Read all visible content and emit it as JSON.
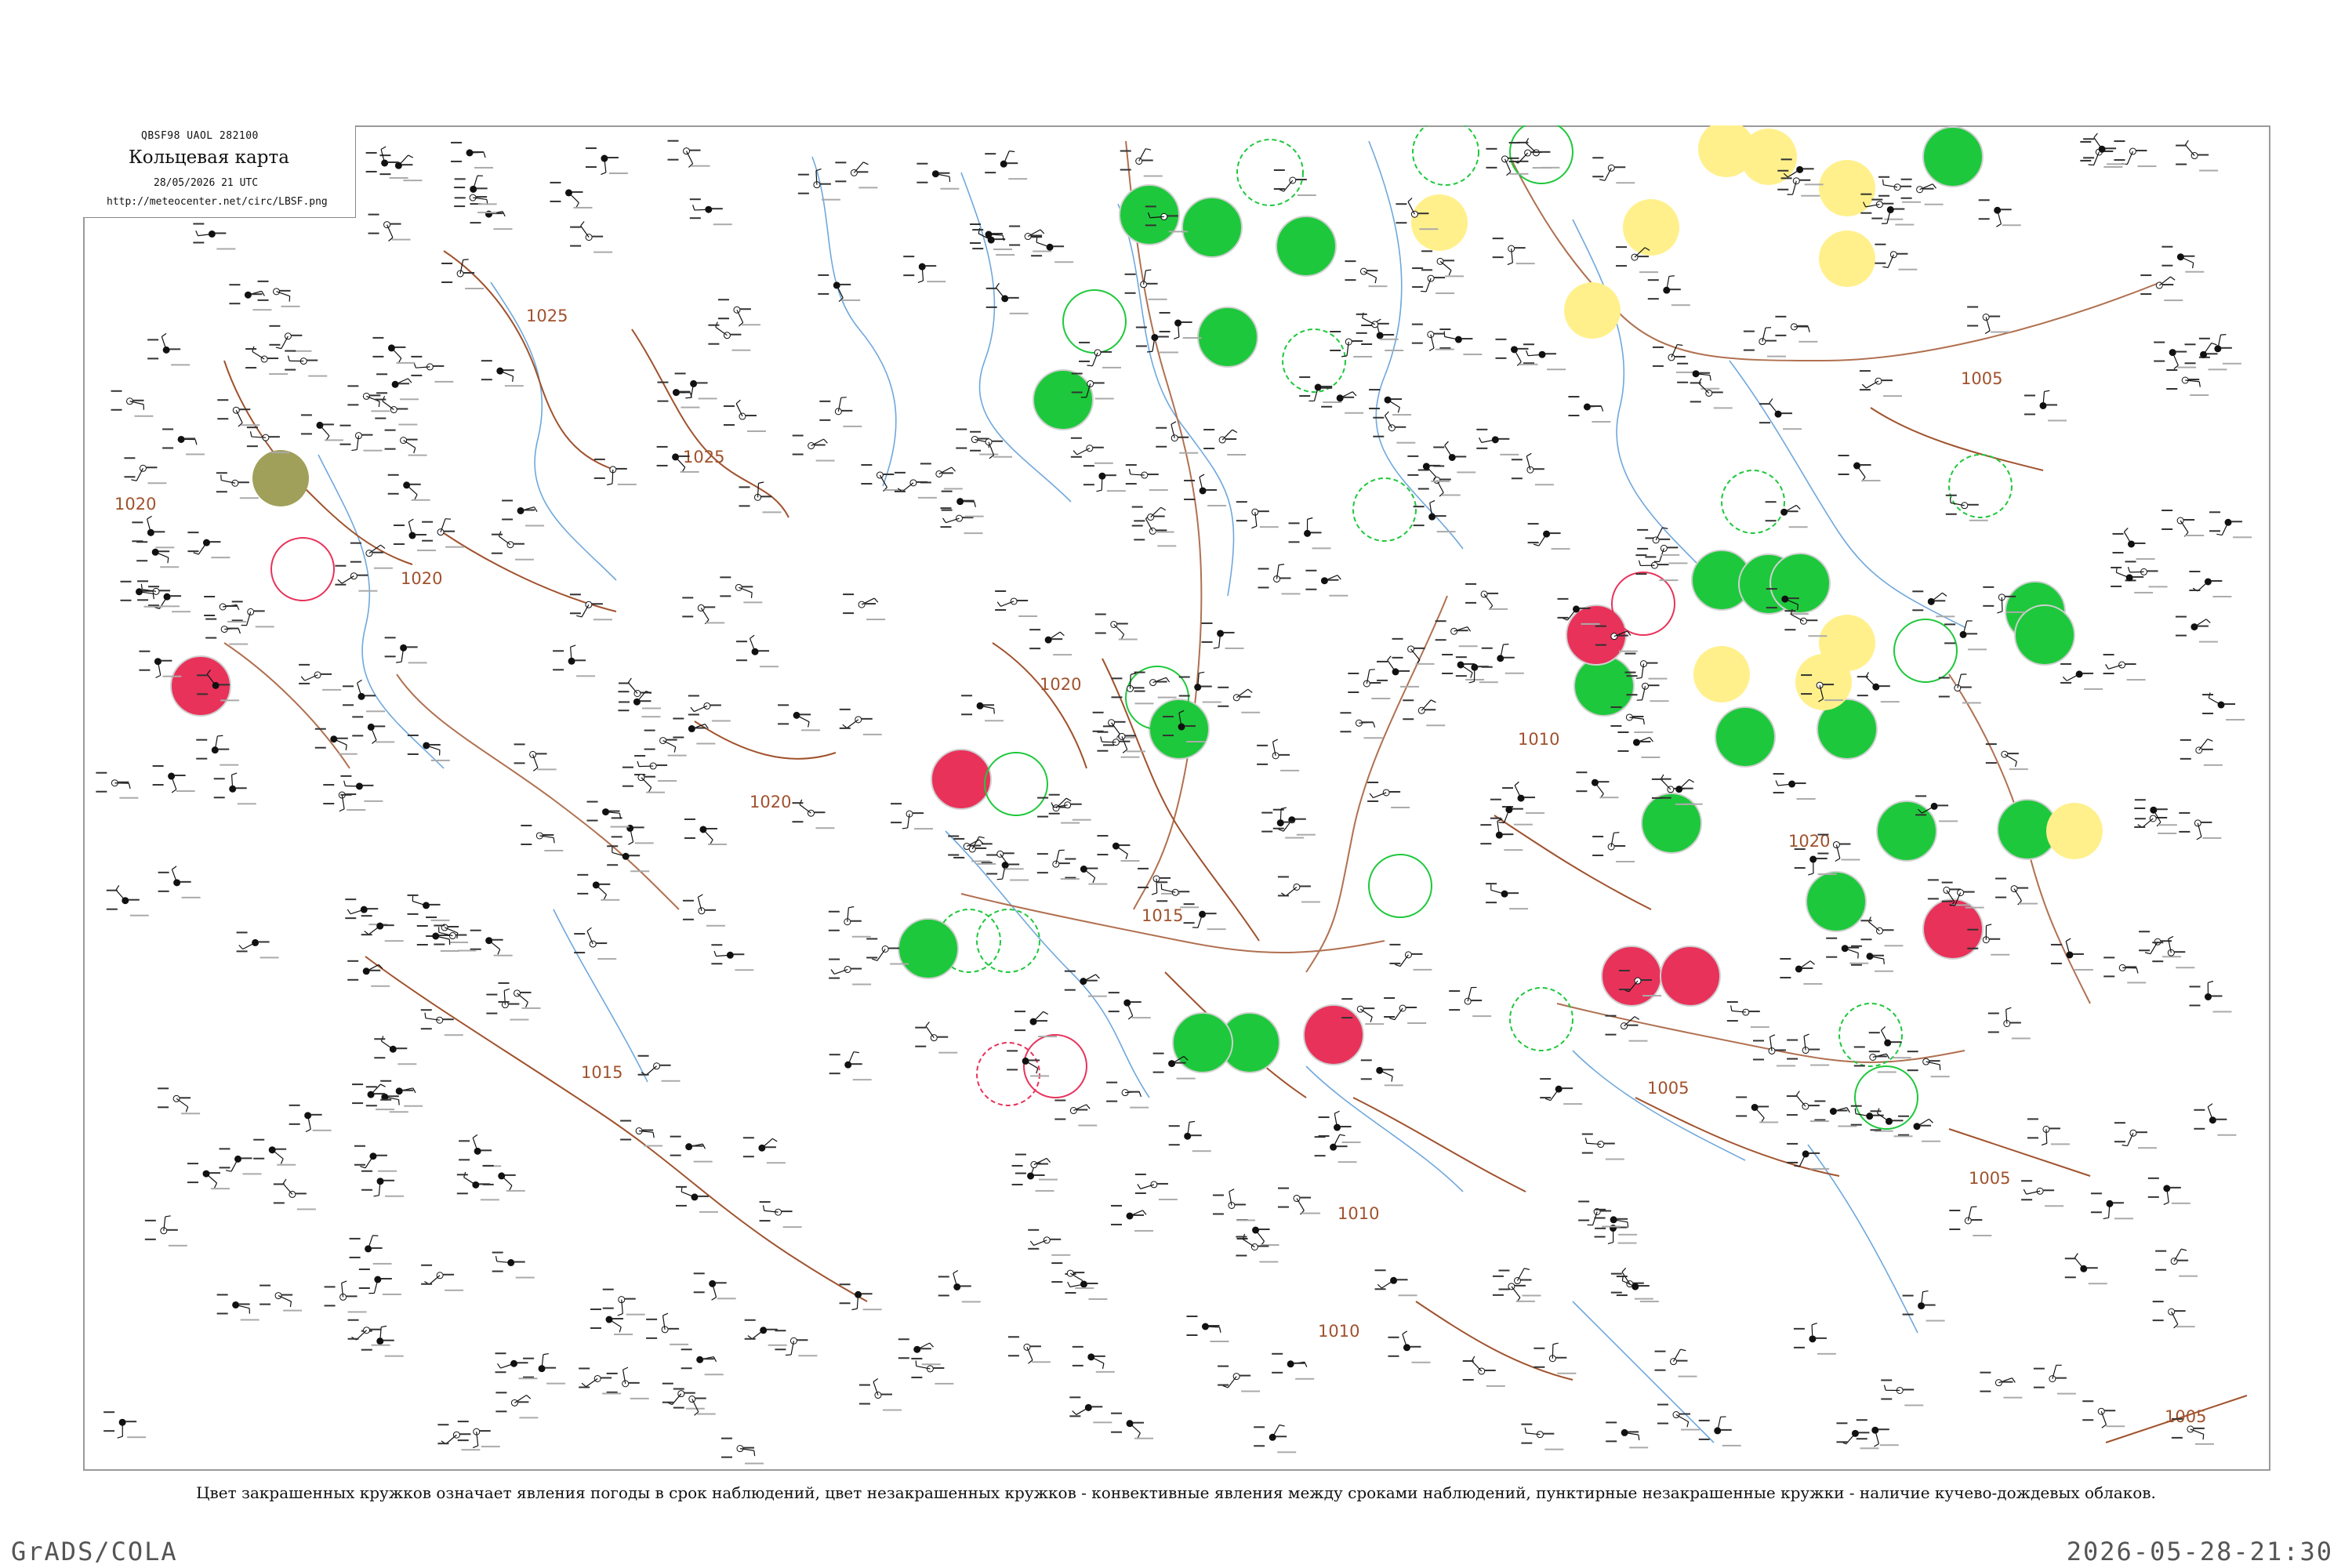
{
  "header": {
    "code": "QBSF98  UAOL  282100",
    "title": "Кольцевая карта",
    "date": "28/05/2026 21 UTC",
    "url": "http://meteocenter.net/circ/LBSF.png"
  },
  "isobars": {
    "labels": [
      "1025",
      "1025",
      "1020",
      "1020",
      "1020",
      "1020",
      "1020",
      "1015",
      "1015",
      "1010",
      "1010",
      "1010",
      "1005",
      "1005",
      "1005",
      "1005"
    ]
  },
  "legend_colors": {
    "green_fill": "#1ec83c",
    "red_fill": "#e8325a",
    "yellow_fill": "#fff08c",
    "olive_fill": "#a0a05a",
    "isobar": "#a0522d",
    "border": "#b07050",
    "water": "#6fa8dc"
  },
  "caption": "Цвет закрашенных кружков означает явления погоды в срок наблюдений, цвет незакрашенных кружков - конвективные явления между сроками наблюдений, пунктирные незакрашенные кружки - наличие кучево-дождевых облаков.",
  "footer": {
    "left": "GrADS/COLA",
    "right": "2026-05-28-21:30"
  }
}
